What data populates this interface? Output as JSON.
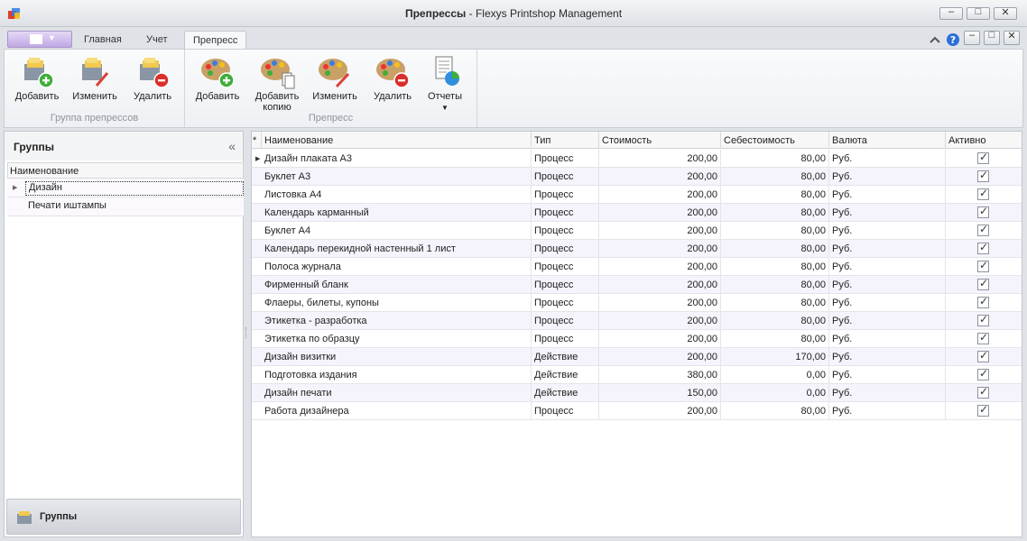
{
  "window": {
    "title_bold": "Препрессы",
    "title_rest": " - Flexys Printshop Management",
    "buttons": {
      "minimize": "–",
      "maximize": "□",
      "close": "✕"
    }
  },
  "ribbon": {
    "tabs": [
      {
        "label": "Главная"
      },
      {
        "label": "Учет"
      },
      {
        "label": "Препресс"
      }
    ],
    "groups": {
      "prepress_groups": {
        "label": "Группа препрессов",
        "add": "Добавить",
        "edit": "Изменить",
        "delete": "Удалить"
      },
      "prepress": {
        "label": "Препресс",
        "add": "Добавить",
        "add_copy_line1": "Добавить",
        "add_copy_line2": "копию",
        "edit": "Изменить",
        "delete": "Удалить",
        "reports": "Отчеты"
      }
    }
  },
  "left_panel": {
    "title": "Группы",
    "collapse": "«",
    "column_header": "Наименование",
    "items": [
      "Дизайн",
      "Печати иштампы"
    ],
    "footer_label": "Группы"
  },
  "grid": {
    "headers": {
      "marker": "*",
      "name": "Наименование",
      "type": "Тип",
      "cost": "Стоимость",
      "self_cost": "Себестоимость",
      "currency": "Валюта",
      "active": "Активно"
    },
    "rows": [
      {
        "name": "Дизайн плаката А3",
        "type": "Процесс",
        "cost": "200,00",
        "self_cost": "80,00",
        "currency": "Руб.",
        "active": true
      },
      {
        "name": "Буклет А3",
        "type": "Процесс",
        "cost": "200,00",
        "self_cost": "80,00",
        "currency": "Руб.",
        "active": true
      },
      {
        "name": "Листовка А4",
        "type": "Процесс",
        "cost": "200,00",
        "self_cost": "80,00",
        "currency": "Руб.",
        "active": true
      },
      {
        "name": "Календарь карманный",
        "type": "Процесс",
        "cost": "200,00",
        "self_cost": "80,00",
        "currency": "Руб.",
        "active": true
      },
      {
        "name": "Буклет А4",
        "type": "Процесс",
        "cost": "200,00",
        "self_cost": "80,00",
        "currency": "Руб.",
        "active": true
      },
      {
        "name": "Календарь перекидной настенный 1 лист",
        "type": "Процесс",
        "cost": "200,00",
        "self_cost": "80,00",
        "currency": "Руб.",
        "active": true
      },
      {
        "name": "Полоса журнала",
        "type": "Процесс",
        "cost": "200,00",
        "self_cost": "80,00",
        "currency": "Руб.",
        "active": true
      },
      {
        "name": "Фирменный бланк",
        "type": "Процесс",
        "cost": "200,00",
        "self_cost": "80,00",
        "currency": "Руб.",
        "active": true
      },
      {
        "name": "Флаеры, билеты, купоны",
        "type": "Процесс",
        "cost": "200,00",
        "self_cost": "80,00",
        "currency": "Руб.",
        "active": true
      },
      {
        "name": "Этикетка - разработка",
        "type": "Процесс",
        "cost": "200,00",
        "self_cost": "80,00",
        "currency": "Руб.",
        "active": true
      },
      {
        "name": "Этикетка по образцу",
        "type": "Процесс",
        "cost": "200,00",
        "self_cost": "80,00",
        "currency": "Руб.",
        "active": true
      },
      {
        "name": "Дизайн визитки",
        "type": "Действие",
        "cost": "200,00",
        "self_cost": "170,00",
        "currency": "Руб.",
        "active": true
      },
      {
        "name": "Подготовка издания",
        "type": "Действие",
        "cost": "380,00",
        "self_cost": "0,00",
        "currency": "Руб.",
        "active": true
      },
      {
        "name": "Дизайн печати",
        "type": "Действие",
        "cost": "150,00",
        "self_cost": "0,00",
        "currency": "Руб.",
        "active": true
      },
      {
        "name": "Работа дизайнера",
        "type": "Процесс",
        "cost": "200,00",
        "self_cost": "80,00",
        "currency": "Руб.",
        "active": true
      }
    ]
  }
}
